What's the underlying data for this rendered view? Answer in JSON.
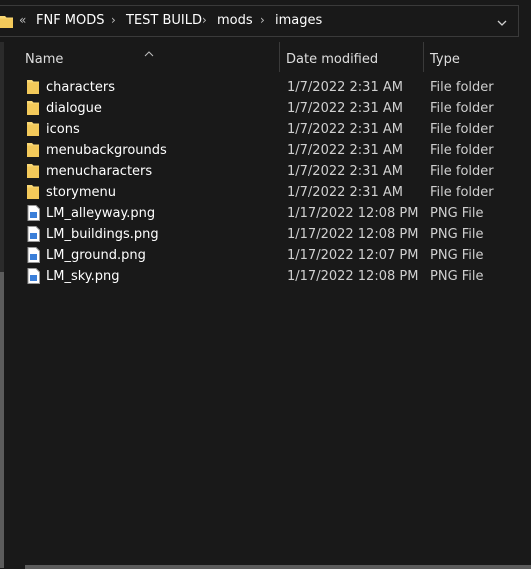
{
  "address_bar": {
    "overflow_chevron": "«",
    "separator": "›",
    "breadcrumbs": [
      "FNF MODS",
      "TEST BUILD",
      "mods",
      "images"
    ],
    "dropdown_icon": "chevron-down-icon"
  },
  "columns": {
    "name": "Name",
    "date_modified": "Date modified",
    "type": "Type"
  },
  "files": [
    {
      "name": "characters",
      "date": "1/7/2022 2:31 AM",
      "type": "File folder",
      "icon": "folder-icon"
    },
    {
      "name": "dialogue",
      "date": "1/7/2022 2:31 AM",
      "type": "File folder",
      "icon": "folder-icon"
    },
    {
      "name": "icons",
      "date": "1/7/2022 2:31 AM",
      "type": "File folder",
      "icon": "folder-icon"
    },
    {
      "name": "menubackgrounds",
      "date": "1/7/2022 2:31 AM",
      "type": "File folder",
      "icon": "folder-icon"
    },
    {
      "name": "menucharacters",
      "date": "1/7/2022 2:31 AM",
      "type": "File folder",
      "icon": "folder-icon"
    },
    {
      "name": "storymenu",
      "date": "1/7/2022 2:31 AM",
      "type": "File folder",
      "icon": "folder-icon"
    },
    {
      "name": "LM_alleyway.png",
      "date": "1/17/2022 12:08 PM",
      "type": "PNG File",
      "icon": "png-file-icon"
    },
    {
      "name": "LM_buildings.png",
      "date": "1/17/2022 12:08 PM",
      "type": "PNG File",
      "icon": "png-file-icon"
    },
    {
      "name": "LM_ground.png",
      "date": "1/17/2022 12:07 PM",
      "type": "PNG File",
      "icon": "png-file-icon"
    },
    {
      "name": "LM_sky.png",
      "date": "1/17/2022 12:08 PM",
      "type": "PNG File",
      "icon": "png-file-icon"
    }
  ],
  "colors": {
    "background": "#191919",
    "folder": "#f8d775",
    "text": "#ffffff",
    "subtext": "#d0d0d0"
  }
}
